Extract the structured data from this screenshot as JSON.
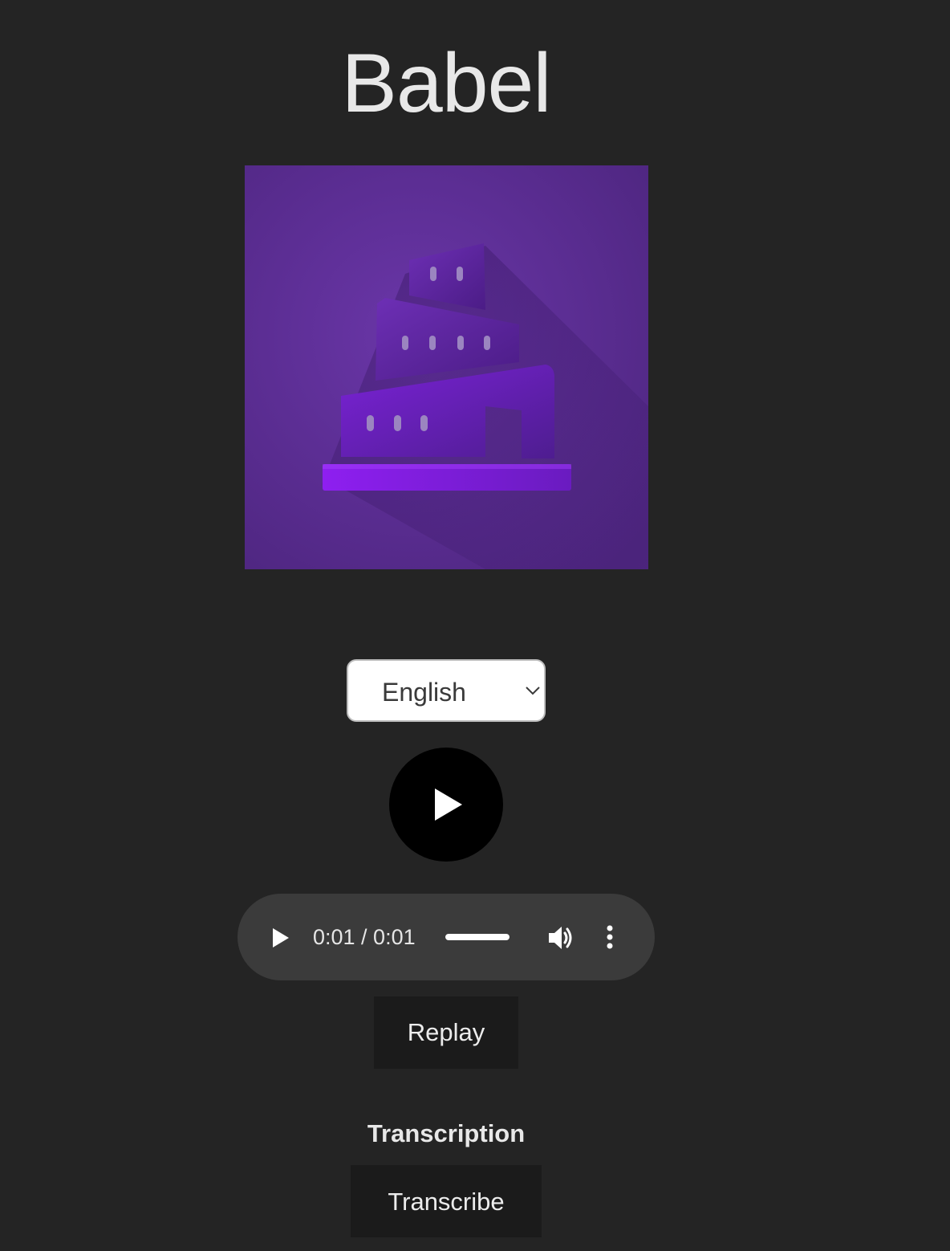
{
  "app": {
    "title": "Babel"
  },
  "logo": {
    "icon": "tower-of-babel-logo",
    "background_color": "#5b2a8c",
    "accent_color": "#8a1fe0"
  },
  "language_select": {
    "selected": "English"
  },
  "play_button": {
    "icon": "play-icon"
  },
  "audio_player": {
    "current_time": "0:01",
    "duration": "0:01",
    "time_label": "0:01 / 0:01",
    "progress": 1.0,
    "icons": [
      "play-icon",
      "volume-icon",
      "more-vertical-icon"
    ]
  },
  "buttons": {
    "replay": "Replay",
    "transcribe": "Transcribe"
  },
  "transcription": {
    "heading": "Transcription"
  }
}
